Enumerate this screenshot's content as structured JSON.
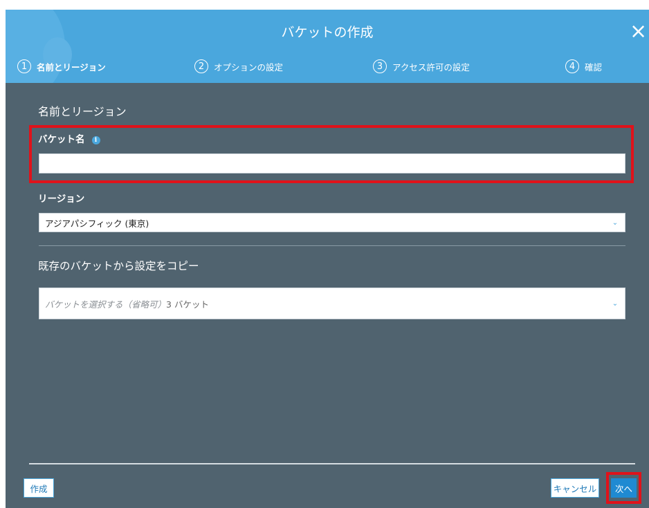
{
  "header": {
    "title": "バケットの作成",
    "close_symbol": "×"
  },
  "steps": [
    {
      "number": "1",
      "label": "名前とリージョン"
    },
    {
      "number": "2",
      "label": "オプションの設定"
    },
    {
      "number": "3",
      "label": "アクセス許可の設定"
    },
    {
      "number": "4",
      "label": "確認"
    }
  ],
  "form": {
    "section_title": "名前とリージョン",
    "bucket_name_label": "バケット名",
    "info_icon_symbol": "i",
    "bucket_name_value": "",
    "region_label": "リージョン",
    "region_value": "アジアパシフィック (東京)",
    "copy_title": "既存のバケットから設定をコピー",
    "copy_placeholder": "バケットを選択する（省略可）",
    "copy_count": "3 バケット",
    "chevron_symbol": "⌄"
  },
  "footer": {
    "create_label": "作成",
    "cancel_label": "キャンセル",
    "next_label": "次へ"
  },
  "colors": {
    "header_bg": "#4aa7dd",
    "body_bg": "#50636f",
    "highlight": "#e0121a",
    "primary_button": "#1f8ad2"
  }
}
